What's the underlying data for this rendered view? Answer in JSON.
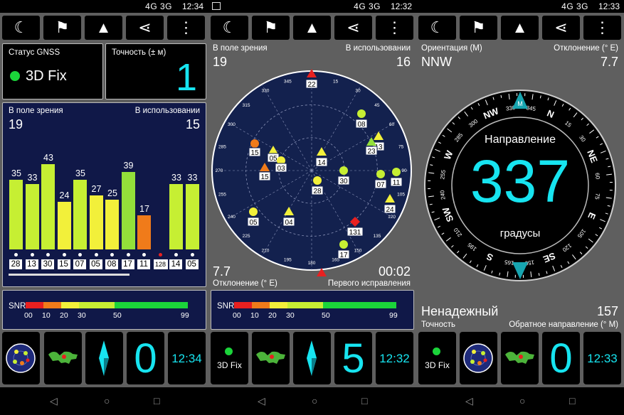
{
  "screens": [
    {
      "status": {
        "time": "12:34",
        "signal": "4G 3G"
      }
    },
    {
      "status": {
        "time": "12:32",
        "signal": "4G 3G"
      }
    },
    {
      "status": {
        "time": "12:33",
        "signal": "4G 3G"
      }
    }
  ],
  "screen1": {
    "gnss_status_label": "Статус GNSS",
    "fix_text": "3D Fix",
    "accuracy_label": "Точность (± м)",
    "accuracy_value": "1",
    "in_view_label": "В поле зрения",
    "in_use_label": "В использовании",
    "in_view_count": "19",
    "in_use_count": "15",
    "time_tile": "12:34",
    "big_tile": "0"
  },
  "chart_data": {
    "type": "bar",
    "categories": [
      "28",
      "13",
      "30",
      "15",
      "07",
      "05",
      "08",
      "17",
      "11",
      "128",
      "14",
      "05"
    ],
    "values": [
      35,
      33,
      43,
      24,
      35,
      27,
      25,
      39,
      17,
      0,
      33,
      33
    ],
    "colors": [
      "#c6ef33",
      "#c6ef33",
      "#c6ef33",
      "#f2f03a",
      "#c6ef33",
      "#f2f03a",
      "#f2f03a",
      "#93e03a",
      "#f07b1a",
      "#000000",
      "#c6ef33",
      "#c6ef33"
    ],
    "value_labels": [
      "35",
      "33",
      "43",
      "24",
      "35",
      "27",
      "25",
      "39",
      "17",
      "",
      "33",
      "33"
    ],
    "ylim": [
      0,
      50
    ]
  },
  "snr": {
    "label": "SNR",
    "ticks": [
      "00",
      "10",
      "20",
      "30",
      "50",
      "99"
    ]
  },
  "screen2": {
    "in_view_label": "В поле зрения",
    "in_use_label": "В использовании",
    "in_view_count": "19",
    "in_use_count": "16",
    "deviation_value": "7.7",
    "deviation_label": "Отклонение (° E)",
    "ttff_value": "00:02",
    "ttff_label": "Первого исправления",
    "fix_text": "3D Fix",
    "big_tile": "5",
    "time_tile": "12:32",
    "sky_azimuths": [
      "345",
      "330",
      "315",
      "300",
      "285",
      "270",
      "255",
      "240",
      "225",
      "210",
      "195",
      "180",
      "165",
      "150",
      "135",
      "120",
      "105",
      "90",
      "75",
      "60",
      "45",
      "30",
      "15"
    ],
    "sats": [
      {
        "prn": "22",
        "color": "#e82020",
        "shape": "triangle"
      },
      {
        "prn": "08",
        "color": "#c6ef33",
        "shape": "circle"
      },
      {
        "prn": "13",
        "color": "#f2f03a",
        "shape": "triangle"
      },
      {
        "prn": "23",
        "color": "#93e03a",
        "shape": "triangle"
      },
      {
        "prn": "15",
        "color": "#f07b1a",
        "shape": "circle"
      },
      {
        "prn": "05",
        "color": "#f2f03a",
        "shape": "triangle"
      },
      {
        "prn": "03",
        "color": "#f2f03a",
        "shape": "circle"
      },
      {
        "prn": "14",
        "color": "#f2f03a",
        "shape": "triangle"
      },
      {
        "prn": "30",
        "color": "#c6ef33",
        "shape": "circle"
      },
      {
        "prn": "07",
        "color": "#c6ef33",
        "shape": "circle"
      },
      {
        "prn": "11",
        "color": "#c6ef33",
        "shape": "circle"
      },
      {
        "prn": "15",
        "color": "#f07b1a",
        "shape": "triangle"
      },
      {
        "prn": "28",
        "color": "#f2f03a",
        "shape": "circle"
      },
      {
        "prn": "24",
        "color": "#f2f03a",
        "shape": "triangle"
      },
      {
        "prn": "05",
        "color": "#f2f03a",
        "shape": "circle"
      },
      {
        "prn": "04",
        "color": "#f2f03a",
        "shape": "triangle"
      },
      {
        "prn": "131",
        "color": "#e82020",
        "shape": "diamond"
      },
      {
        "prn": "17",
        "color": "#c6ef33",
        "shape": "circle"
      },
      {
        "prn": "03",
        "color": "#e82020",
        "shape": "triangle"
      }
    ]
  },
  "screen3": {
    "orientation_label": "Ориентация (M)",
    "orientation_value": "NNW",
    "deviation_label": "Отклонение (° E)",
    "deviation_value": "7.7",
    "heading_label": "Направление",
    "heading_value": "337",
    "units_label": "градусы",
    "reliability": "Ненадежный",
    "accuracy_label": "Точность",
    "back_heading_value": "157",
    "back_heading_label": "Обратное направление (° M)",
    "fix_text": "3D Fix",
    "big_tile": "0",
    "time_tile": "12:33",
    "compass_marks": [
      "N",
      "NE",
      "E",
      "SE",
      "S",
      "SW",
      "W",
      "NW",
      "M"
    ],
    "compass_degrees": [
      "15",
      "30",
      "60",
      "75",
      "105",
      "120",
      "150",
      "165",
      "195",
      "210",
      "240",
      "255",
      "285",
      "300",
      "330",
      "345"
    ]
  },
  "icons": [
    "moon-icon",
    "person-sign-icon",
    "navigation-arrow-icon",
    "share-icon",
    "more-vert-icon"
  ]
}
